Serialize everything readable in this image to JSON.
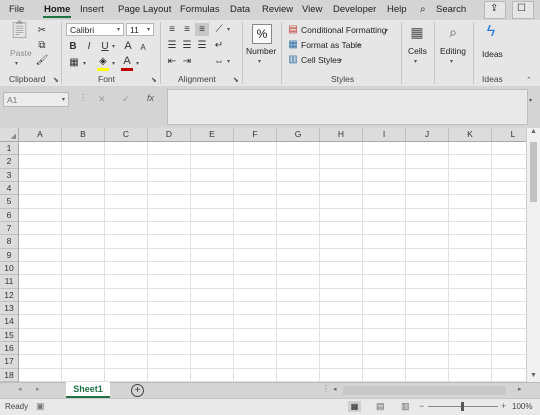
{
  "tabs": [
    "File",
    "Home",
    "Insert",
    "Page Layout",
    "Formulas",
    "Data",
    "Review",
    "View",
    "Developer",
    "Help"
  ],
  "search_label": "Search",
  "clipboard": {
    "paste": "Paste",
    "label": "Clipboard"
  },
  "font": {
    "name": "Calibri",
    "size": "11",
    "bold": "B",
    "italic": "I",
    "underline": "U",
    "grow": "A",
    "shrink": "A",
    "color_letter": "A",
    "label": "Font"
  },
  "alignment": {
    "label": "Alignment"
  },
  "number": {
    "symbol": "%",
    "label": "Number"
  },
  "styles": {
    "conditional": "Conditional Formatting",
    "format_table": "Format as Table",
    "cell_styles": "Cell Styles",
    "label": "Styles"
  },
  "cells": {
    "label": "Cells"
  },
  "editing": {
    "label": "Editing"
  },
  "ideas": {
    "button": "Ideas",
    "label": "Ideas"
  },
  "formula_bar": {
    "name_box": "A1",
    "fx": "fx",
    "cancel": "✕",
    "enter": "✓",
    "value": ""
  },
  "columns": [
    "A",
    "B",
    "C",
    "D",
    "E",
    "F",
    "G",
    "H",
    "I",
    "J",
    "K",
    "L"
  ],
  "rows": [
    "1",
    "2",
    "3",
    "4",
    "5",
    "6",
    "7",
    "8",
    "9",
    "10",
    "11",
    "12",
    "13",
    "14",
    "15",
    "16",
    "17",
    "18"
  ],
  "sheet_tab": "Sheet1",
  "status": {
    "ready": "Ready",
    "zoom": "100%",
    "zoom_minus": "−",
    "zoom_plus": "+"
  },
  "colors": {
    "accent": "#217346",
    "font_color": "#c00000",
    "highlight": "#ffff00"
  }
}
